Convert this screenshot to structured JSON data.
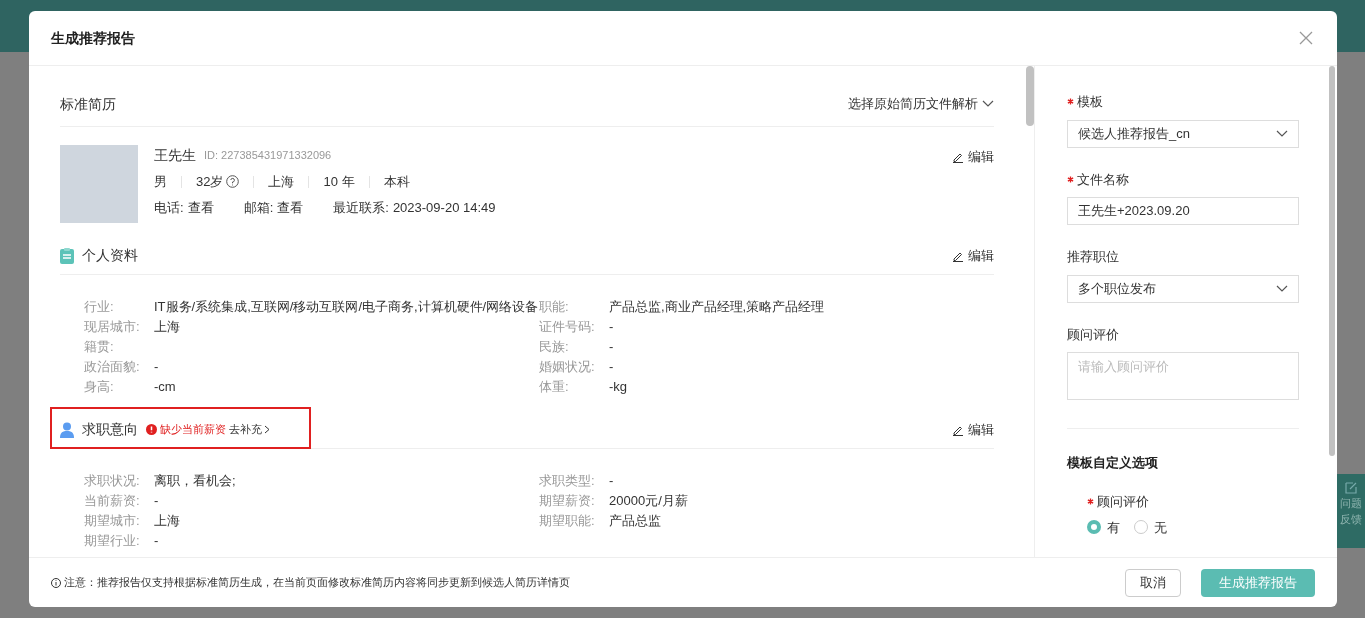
{
  "dialog": {
    "title": "生成推荐报告"
  },
  "resume": {
    "title": "标准简历",
    "parse_select": "选择原始简历文件解析",
    "candidate": {
      "name": "王先生",
      "id": "ID: 227385431971332096",
      "edit": "编辑",
      "facts": [
        {
          "text": "男",
          "help": false
        },
        {
          "text": "32岁",
          "help": true
        },
        {
          "text": "上海",
          "help": false
        },
        {
          "text": "10 年",
          "help": false
        },
        {
          "text": "本科",
          "help": false
        }
      ],
      "contacts": [
        {
          "label": "电话:",
          "value": "查看"
        },
        {
          "label": "邮箱:",
          "value": "查看"
        },
        {
          "label": "最近联系:",
          "value": "2023-09-20 14:49"
        }
      ]
    },
    "sections": [
      {
        "title": "个人资料",
        "edit": "编辑",
        "highlighted": false,
        "fields_left": [
          {
            "label": "行业:",
            "value": "IT服务/系统集成,互联网/移动互联网/电子商务,计算机硬件/网络设备"
          },
          {
            "label": "现居城市:",
            "value": "上海"
          },
          {
            "label": "籍贯:"
          },
          {
            "label": "政治面貌:",
            "value": "-"
          },
          {
            "label": "身高:",
            "value": "-cm"
          }
        ],
        "fields_right": [
          {
            "label": "职能:",
            "value": "产品总监,商业产品经理,策略产品经理"
          },
          {
            "label": "证件号码:",
            "value": "-"
          },
          {
            "label": "民族:",
            "value": "-"
          },
          {
            "label": "婚姻状况:",
            "value": "-"
          },
          {
            "label": "体重:",
            "value": "-kg"
          }
        ]
      },
      {
        "title": "求职意向",
        "edit": "编辑",
        "highlighted": true,
        "warning": "缺少当前薪资",
        "action": "去补充",
        "fields_left": [
          {
            "label": "求职状况:",
            "value": "离职，看机会;"
          },
          {
            "label": "当前薪资:",
            "value": "-"
          },
          {
            "label": "期望城市:",
            "value": "上海"
          },
          {
            "label": "期望行业:",
            "value": "-"
          }
        ],
        "fields_right": [
          {
            "label": "求职类型:",
            "value": "-"
          },
          {
            "label": "期望薪资:",
            "value": "20000元/月薪"
          },
          {
            "label": "期望职能:",
            "value": "产品总监"
          }
        ]
      }
    ]
  },
  "form": {
    "fields": [
      {
        "kind": "select",
        "label": "模板",
        "required": true,
        "value": "候选人推荐报告_cn"
      },
      {
        "kind": "input",
        "label": "文件名称",
        "required": true,
        "value": "王先生+2023.09.20"
      },
      {
        "kind": "select",
        "label": "推荐职位",
        "required": false,
        "value": "多个职位发布"
      },
      {
        "kind": "textarea",
        "label": "顾问评价",
        "required": false,
        "placeholder": "请输入顾问评价"
      }
    ],
    "custom_title": "模板自定义选项",
    "options": [
      {
        "label": "顾问评价",
        "required": true,
        "choices": [
          {
            "label": "有",
            "selected": true
          },
          {
            "label": "无",
            "selected": false
          }
        ]
      }
    ]
  },
  "footer": {
    "note": "注意：推荐报告仅支持根据标准简历生成，在当前页面修改标准简历内容将同步更新到候选人简历详情页",
    "buttons": [
      {
        "kind": "default",
        "label": "取消"
      },
      {
        "kind": "primary",
        "label": "生成推荐报告"
      }
    ]
  },
  "feedback_tab": {
    "lines": [
      "问题",
      "反馈"
    ]
  }
}
